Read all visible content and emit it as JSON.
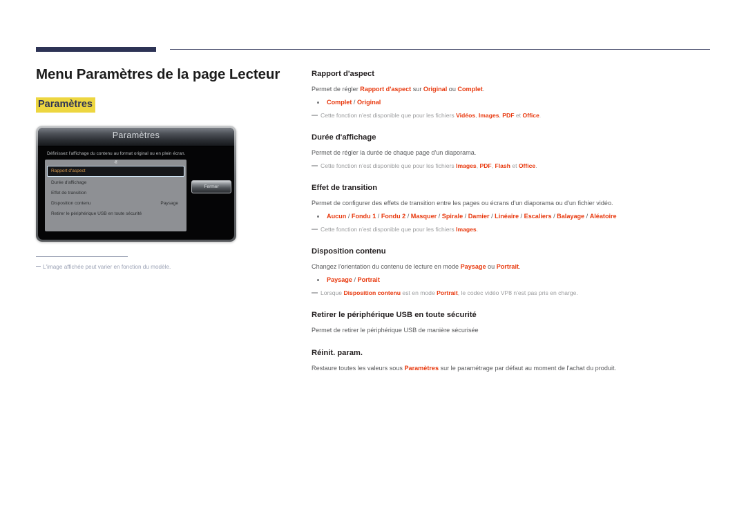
{
  "header": {
    "rule_accent_color": "#2d3355",
    "rule_line_color": "#4a4f6e"
  },
  "left": {
    "page_title": "Menu Paramètres de la page Lecteur",
    "subtitle": "Paramètres",
    "subtitle_highlight_color": "#edd640",
    "footnote": "L'image affichée peut varier en fonction du modèle."
  },
  "osd": {
    "title": "Paramètres",
    "description": "Définissez l'affichage du contenu au format original ou en plein écran.",
    "scroll_up_icon": "chevron-up-icon",
    "scroll_down_icon": "chevron-down-icon",
    "scroll_up_glyph": "ⱏ",
    "scroll_down_glyph": "ⱟ",
    "items": [
      {
        "label": "Rapport d'aspect",
        "value": "",
        "selected": true
      },
      {
        "label": "Durée d'affichage",
        "value": "",
        "selected": false
      },
      {
        "label": "Effet de transition",
        "value": "",
        "selected": false
      },
      {
        "label": "Disposition contenu",
        "value": "Paysage",
        "selected": false
      },
      {
        "label": "Retirer le périphérique USB en toute sécurité",
        "value": "",
        "selected": false
      }
    ],
    "close_button": "Fermer",
    "selected_text_color": "#d89a4e",
    "selected_border_color": "#cfe2f2"
  },
  "accent": {
    "red": "#e8380d",
    "body_gray": "#58595b",
    "note_gray": "#9b9c9e"
  },
  "sections": [
    {
      "title": "Rapport d'aspect",
      "body_parts": [
        {
          "t": "Permet de régler ",
          "hl": false
        },
        {
          "t": "Rapport d'aspect",
          "hl": true
        },
        {
          "t": " sur ",
          "hl": false
        },
        {
          "t": "Original",
          "hl": true
        },
        {
          "t": " ou ",
          "hl": false
        },
        {
          "t": "Complet",
          "hl": true
        },
        {
          "t": ".",
          "hl": false
        }
      ],
      "bullet_parts": [
        {
          "t": "Complet",
          "hl": true
        },
        {
          "t": " / ",
          "hl": false
        },
        {
          "t": "Original",
          "hl": true
        }
      ],
      "note_parts": [
        {
          "t": "Cette fonction n'est disponible que pour les fichiers ",
          "hl": false
        },
        {
          "t": "Vidéos",
          "hl": true
        },
        {
          "t": ", ",
          "hl": false
        },
        {
          "t": "Images",
          "hl": true
        },
        {
          "t": ", ",
          "hl": false
        },
        {
          "t": "PDF",
          "hl": true
        },
        {
          "t": " et ",
          "hl": false
        },
        {
          "t": "Office",
          "hl": true
        },
        {
          "t": ".",
          "hl": false
        }
      ]
    },
    {
      "title": "Durée d'affichage",
      "body_parts": [
        {
          "t": "Permet de régler la durée de chaque page d'un diaporama.",
          "hl": false
        }
      ],
      "bullet_parts": [],
      "note_parts": [
        {
          "t": "Cette fonction n'est disponible que pour les fichiers ",
          "hl": false
        },
        {
          "t": "Images",
          "hl": true
        },
        {
          "t": ", ",
          "hl": false
        },
        {
          "t": "PDF",
          "hl": true
        },
        {
          "t": ", ",
          "hl": false
        },
        {
          "t": "Flash",
          "hl": true
        },
        {
          "t": " et ",
          "hl": false
        },
        {
          "t": "Office",
          "hl": true
        },
        {
          "t": ".",
          "hl": false
        }
      ]
    },
    {
      "title": "Effet de transition",
      "body_parts": [
        {
          "t": "Permet de configurer des effets de transition entre les pages ou écrans d'un diaporama ou d'un fichier vidéo.",
          "hl": false
        }
      ],
      "bullet_parts": [
        {
          "t": "Aucun",
          "hl": true
        },
        {
          "t": " / ",
          "hl": false
        },
        {
          "t": "Fondu 1",
          "hl": true
        },
        {
          "t": " / ",
          "hl": false
        },
        {
          "t": "Fondu 2",
          "hl": true
        },
        {
          "t": " / ",
          "hl": false
        },
        {
          "t": "Masquer",
          "hl": true
        },
        {
          "t": " / ",
          "hl": false
        },
        {
          "t": "Spirale",
          "hl": true
        },
        {
          "t": " / ",
          "hl": false
        },
        {
          "t": "Damier",
          "hl": true
        },
        {
          "t": " / ",
          "hl": false
        },
        {
          "t": "Linéaire",
          "hl": true
        },
        {
          "t": " / ",
          "hl": false
        },
        {
          "t": "Escaliers",
          "hl": true
        },
        {
          "t": " / ",
          "hl": false
        },
        {
          "t": "Balayage",
          "hl": true
        },
        {
          "t": " / ",
          "hl": false
        },
        {
          "t": "Aléatoire",
          "hl": true
        }
      ],
      "note_parts": [
        {
          "t": "Cette fonction n'est disponible que pour les fichiers ",
          "hl": false
        },
        {
          "t": "Images",
          "hl": true
        },
        {
          "t": ".",
          "hl": false
        }
      ]
    },
    {
      "title": "Disposition contenu",
      "body_parts": [
        {
          "t": "Changez l'orientation du contenu de lecture en mode ",
          "hl": false
        },
        {
          "t": "Paysage",
          "hl": true
        },
        {
          "t": " ou ",
          "hl": false
        },
        {
          "t": "Portrait",
          "hl": true
        },
        {
          "t": ".",
          "hl": false
        }
      ],
      "bullet_parts": [
        {
          "t": "Paysage",
          "hl": true
        },
        {
          "t": " / ",
          "hl": false
        },
        {
          "t": "Portrait",
          "hl": true
        }
      ],
      "note_parts": [
        {
          "t": "Lorsque ",
          "hl": false
        },
        {
          "t": "Disposition contenu",
          "hl": true
        },
        {
          "t": " est en mode ",
          "hl": false
        },
        {
          "t": "Portrait",
          "hl": true
        },
        {
          "t": ", le codec vidéo VP8 n'est pas pris en charge.",
          "hl": false
        }
      ]
    },
    {
      "title": "Retirer le périphérique USB en toute sécurité",
      "body_parts": [
        {
          "t": "Permet de retirer le périphérique USB de manière sécurisée",
          "hl": false
        }
      ],
      "bullet_parts": [],
      "note_parts": []
    },
    {
      "title": "Réinit. param.",
      "body_parts": [
        {
          "t": "Restaure toutes les valeurs sous ",
          "hl": false
        },
        {
          "t": "Paramètres",
          "hl": true
        },
        {
          "t": " sur le paramétrage par défaut au moment de l'achat du produit.",
          "hl": false
        }
      ],
      "bullet_parts": [],
      "note_parts": []
    }
  ]
}
